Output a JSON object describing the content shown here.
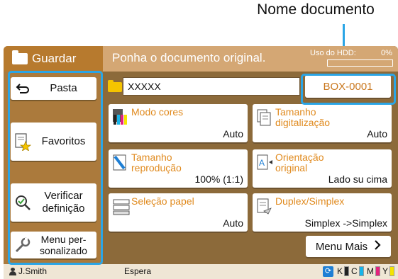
{
  "callout": {
    "label": "Nome documento"
  },
  "header": {
    "title": "Guardar",
    "instruction": "Ponha o documento original.",
    "hdd_label": "Uso do HDD:",
    "hdd_percent": "0%"
  },
  "sidebar": {
    "items": [
      {
        "label": "Pasta",
        "icon": "back-arrow-icon"
      },
      {
        "label": "Favoritos",
        "icon": "favorites-icon"
      },
      {
        "label": "Verificar definição",
        "icon": "check-magnifier-icon"
      },
      {
        "label": "Menu per-sonalizado",
        "icon": "wrench-icon"
      }
    ]
  },
  "document": {
    "name_value": "XXXXX",
    "box_label": "BOX-0001"
  },
  "tiles": [
    {
      "label": "Modo cores",
      "value": "Auto",
      "icon": "color-mode-icon"
    },
    {
      "label": "Tamanho digitalização",
      "value": "Auto",
      "icon": "scan-size-icon"
    },
    {
      "label": "Tamanho reprodução",
      "value": "100% (1:1)",
      "icon": "reproduction-size-icon"
    },
    {
      "label": "Orientação original",
      "value": "Lado su cima",
      "icon": "orientation-icon"
    },
    {
      "label": "Seleção papel",
      "value": "Auto",
      "icon": "paper-tray-icon"
    },
    {
      "label": "Duplex/Simplex",
      "value": "Simplex ->Simplex",
      "icon": "duplex-icon"
    }
  ],
  "more_menu": {
    "label": "Menu Mais"
  },
  "status": {
    "user": "J.Smith",
    "state": "Espera",
    "inks": [
      {
        "label": "K",
        "color": "#222222"
      },
      {
        "label": "C",
        "color": "#18b4e8"
      },
      {
        "label": "M",
        "color": "#e4237d"
      },
      {
        "label": "Y",
        "color": "#f5e400"
      }
    ]
  },
  "colors": {
    "accent": "#2aa5e6",
    "brand": "#b77a2e",
    "tile_label": "#e08a1e"
  }
}
